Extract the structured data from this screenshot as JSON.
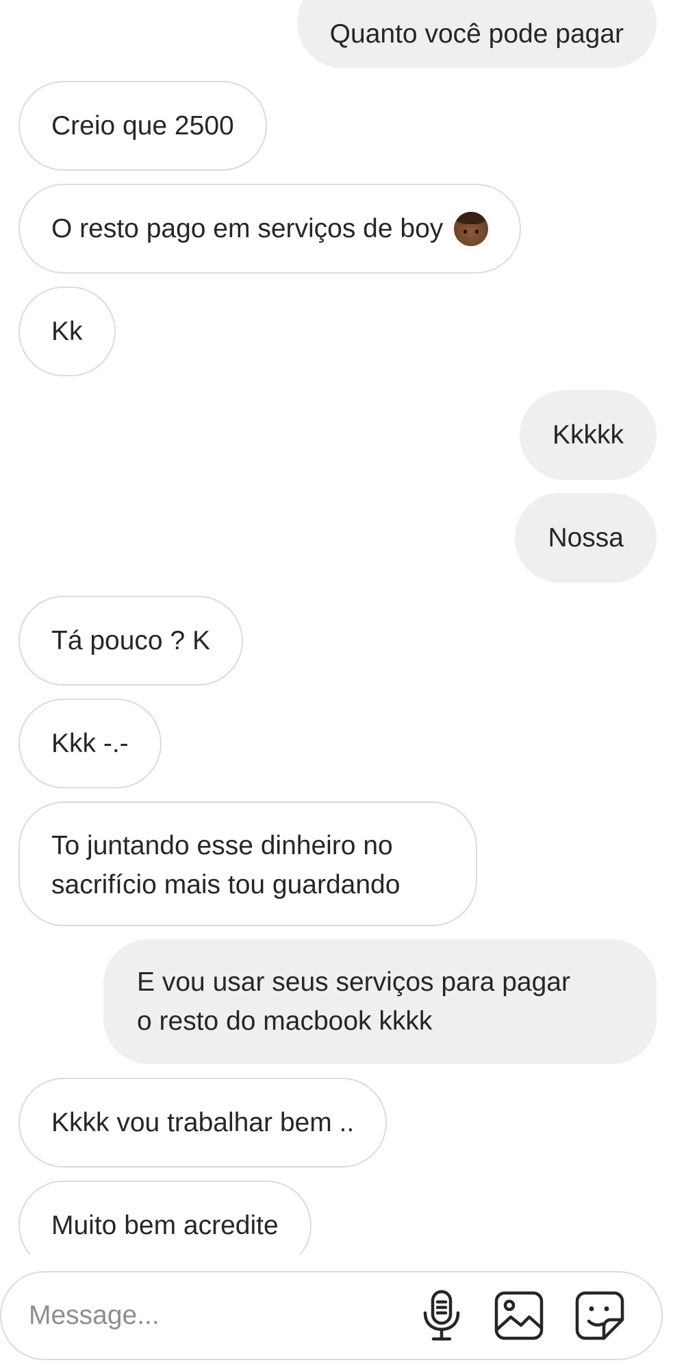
{
  "messages": [
    {
      "direction": "out",
      "lines": [
        "Quanto você pode pagar"
      ]
    },
    {
      "direction": "in",
      "lines": [
        "Creio que 2500"
      ]
    },
    {
      "direction": "in",
      "lines": [
        "O resto pago em serviços de boy"
      ],
      "emoji": "boy-medium-dark-skin-emoji"
    },
    {
      "direction": "in",
      "lines": [
        "Kk"
      ]
    },
    {
      "direction": "out",
      "lines": [
        "Kkkkk"
      ]
    },
    {
      "direction": "out",
      "lines": [
        "Nossa"
      ]
    },
    {
      "direction": "in",
      "lines": [
        "Tá pouco ? K"
      ]
    },
    {
      "direction": "in",
      "lines": [
        "Kkk -.-"
      ]
    },
    {
      "direction": "in",
      "lines": [
        "To juntando esse dinheiro no",
        "sacrifício mais tou guardando"
      ]
    },
    {
      "direction": "out",
      "lines": [
        "E vou usar seus serviços para pagar",
        "o resto do macbook kkkk"
      ]
    },
    {
      "direction": "in",
      "lines": [
        "Kkkk vou trabalhar bem .."
      ]
    },
    {
      "direction": "in",
      "lines": [
        "Muito bem acredite"
      ]
    }
  ],
  "composer": {
    "placeholder": "Message...",
    "icons": [
      "microphone-icon",
      "image-icon",
      "sticker-icon"
    ]
  },
  "colors": {
    "incoming_bg": "#ffffff",
    "incoming_border": "#dbdbdb",
    "outgoing_bg": "#efefef",
    "text": "#262626",
    "placeholder": "#8e8e8e"
  }
}
